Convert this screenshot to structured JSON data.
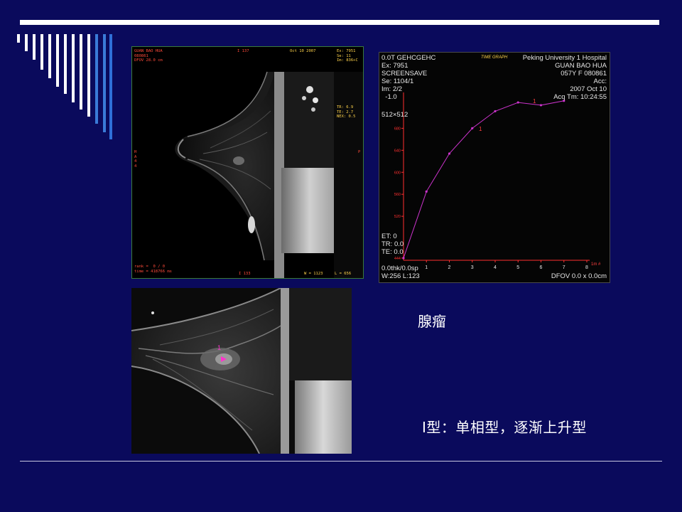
{
  "mri_main": {
    "header_left": "GUAN BAO HUA\n080861\nDFOV 28.0 cm",
    "header_slice": "I 137",
    "header_date": "Oct 10 2007",
    "header_right": "Ex: 7951\nSe: 11\nIm: 836+C",
    "params_right": "TR: 6.9\nTE: 2.7\nNEX: 0.5",
    "side_left": "H\nA\n4\n4",
    "side_right": "P",
    "footer_left": "rank =  0 / 0\ntime = 418766 ms",
    "footer_slice": "I 133",
    "footer_w": "W = 1123",
    "footer_l": "L = 656"
  },
  "curve": {
    "title": "TIME GRAPH",
    "header_left": "0.0T GEHCGEHC\nEx: 7951\nSCREENSAVE\nSe: 1104/1\nIm: 2/2\n  -1.0",
    "matrix": "512×512",
    "header_right": "Peking University 1 Hospital\nGUAN BAO HUA\n057Y F 080861\nAcc:\n2007 Oct 10\nAcq Tm: 10:24:55",
    "footer_left": "ET: 0\nTR: 0.0\nTE: 0.0",
    "footer_left2": "0.0thk/0.0sp\nW:256 L:123",
    "footer_right": "DFOV 0.0 x 0.0cm",
    "marker": "1",
    "x_axis_unit": "1m #",
    "curve_color": "#cc33cc",
    "axis_color": "#ff3030"
  },
  "chart_data": {
    "type": "line",
    "title": "TIME GRAPH",
    "x": [
      0,
      1,
      2,
      3,
      4,
      5,
      6,
      7
    ],
    "y": [
      444,
      565,
      634,
      680,
      711,
      727,
      722,
      730
    ],
    "xlim": [
      0,
      8
    ],
    "ylim": [
      440,
      740
    ],
    "x_ticks": [
      "1",
      "2",
      "3",
      "4",
      "5",
      "6",
      "7",
      "8"
    ],
    "y_ticks": [
      "444",
      "520",
      "560",
      "600",
      "640",
      "680"
    ]
  },
  "mri_zoom": {
    "marker": "1",
    "marker_color": "#ff33cc"
  },
  "captions": {
    "title": "腺瘤",
    "type_label": "Ⅰ型：单相型，逐渐上升型"
  }
}
